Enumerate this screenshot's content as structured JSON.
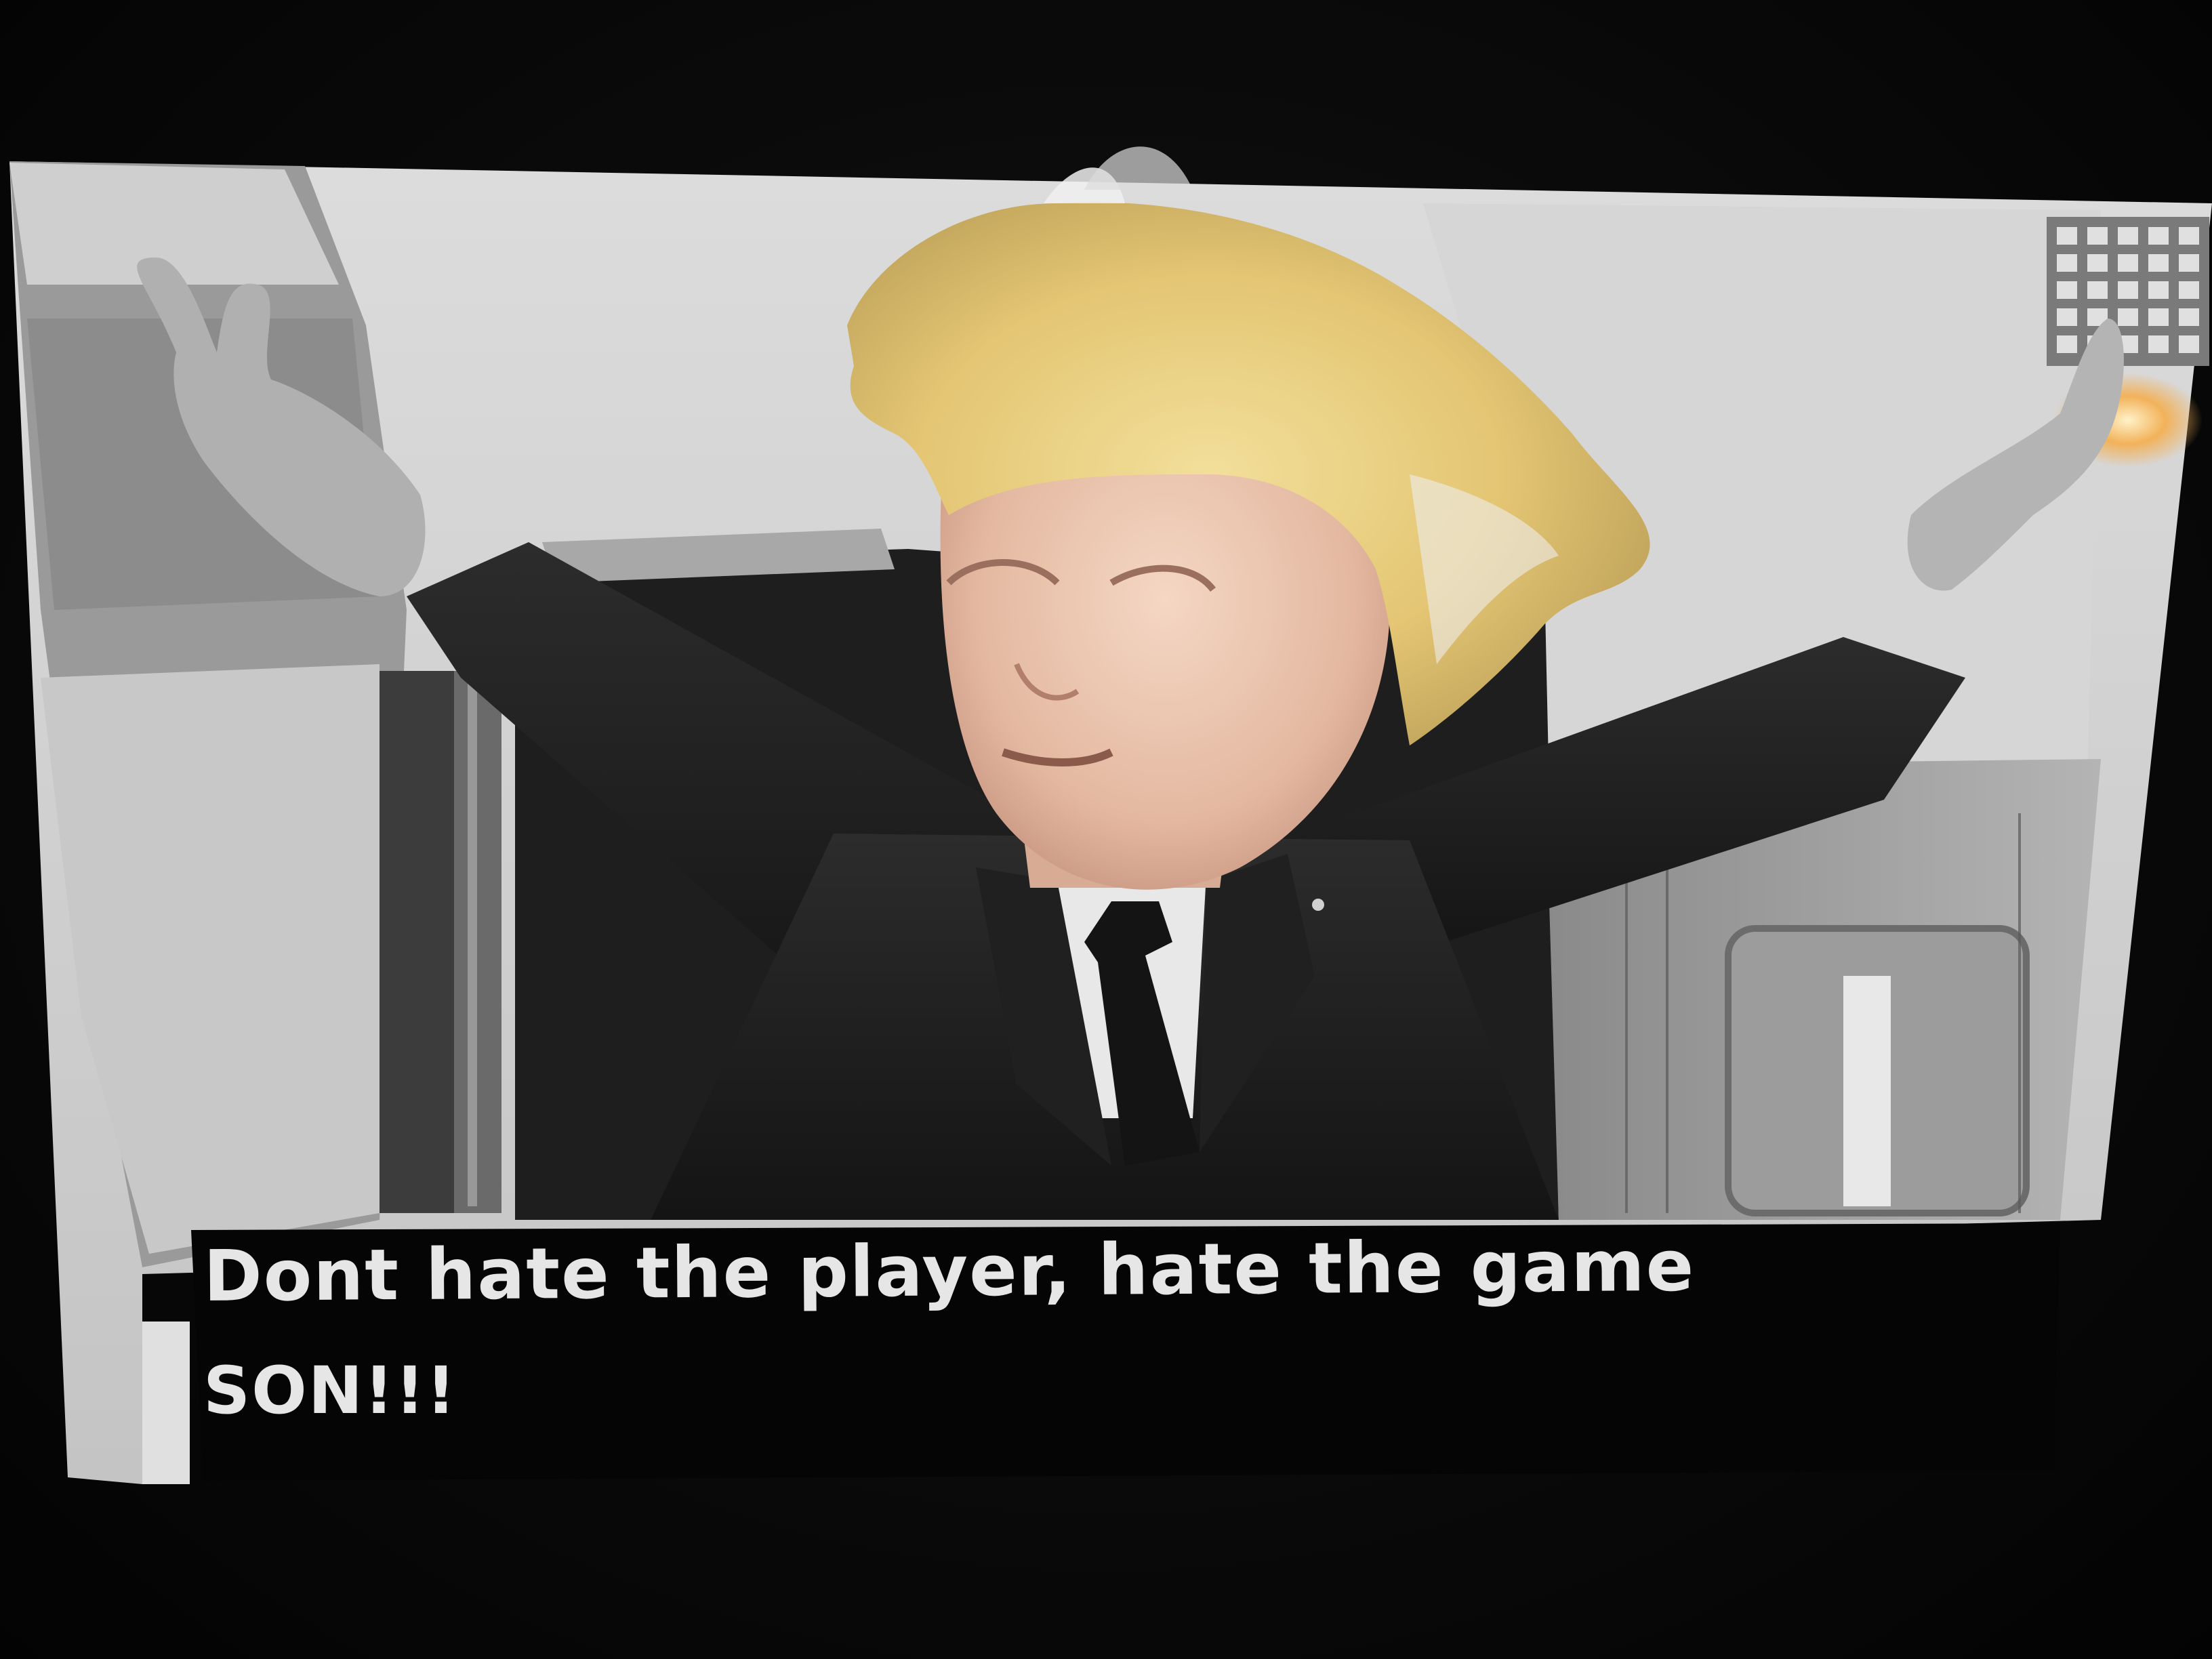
{
  "caption": {
    "line1": "Dont hate the player, hate the game",
    "line2": "SON!!!"
  },
  "colors": {
    "caption_text": "#e6e6e6",
    "caption_background": "#050505",
    "hair": "#e8cf7a"
  }
}
